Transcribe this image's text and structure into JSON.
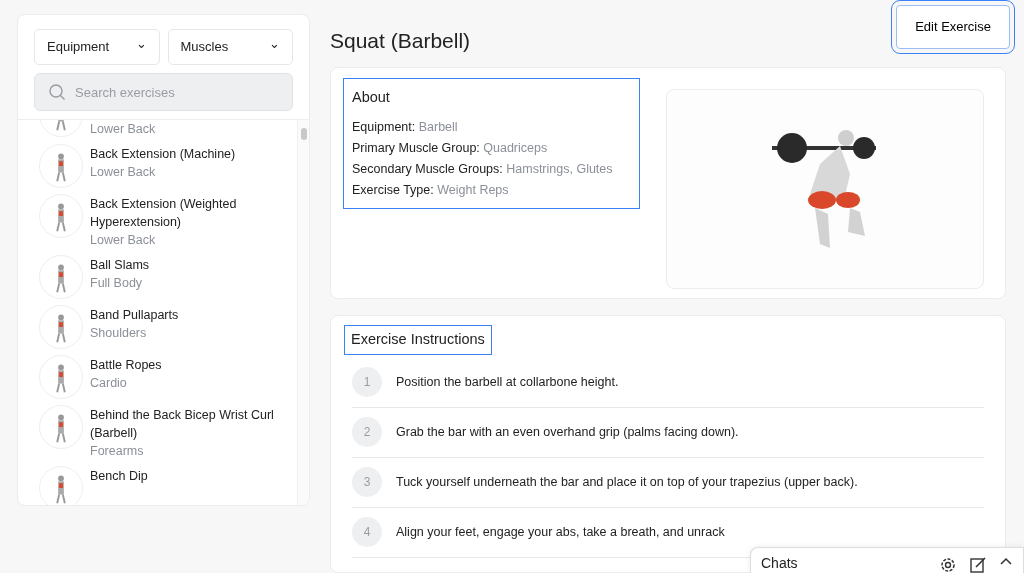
{
  "filters": [
    {
      "label": "Equipment",
      "caret": "⌄"
    },
    {
      "label": "Muscles",
      "caret": "⌄"
    }
  ],
  "search": {
    "placeholder": "Search exercises"
  },
  "exercises": [
    {
      "subtitle": "Lower Back"
    },
    {
      "title": "Back Extension (Machine)",
      "subtitle": "Lower Back"
    },
    {
      "title": "Back Extension (Weighted Hyperextension)",
      "subtitle": "Lower Back"
    },
    {
      "title": "Ball Slams",
      "subtitle": "Full Body"
    },
    {
      "title": "Band Pullaparts",
      "subtitle": "Shoulders"
    },
    {
      "title": "Battle Ropes",
      "subtitle": "Cardio"
    },
    {
      "title": "Behind the Back Bicep Wrist Curl (Barbell)",
      "subtitle": "Forearms"
    },
    {
      "title": "Bench Dip"
    }
  ],
  "page_title": "Squat (Barbell)",
  "edit_button": {
    "label": "Edit Exercise",
    "highlighted": true
  },
  "about": {
    "heading": "About",
    "highlighted": true,
    "fields": [
      {
        "label": "Equipment:",
        "value": "Barbell"
      },
      {
        "label": "Primary Muscle Group:",
        "value": "Quadriceps"
      },
      {
        "label": "Secondary Muscle Groups:",
        "value": "Hamstrings, Glutes"
      },
      {
        "label": "Exercise Type:",
        "value": "Weight Reps"
      }
    ]
  },
  "instructions": {
    "heading": "Exercise Instructions",
    "highlighted": true,
    "steps": [
      {
        "number": "1",
        "text": "Position the barbell at collarbone height."
      },
      {
        "number": "2",
        "text": "Grab the bar with an even overhand grip (palms facing down)."
      },
      {
        "number": "3",
        "text": "Tuck yourself underneath the bar and place it on top of your trapezius (upper back)."
      },
      {
        "number": "4",
        "text": "Align your feet, engage your abs, take a breath, and unrack"
      }
    ]
  },
  "chats": {
    "title": "Chats"
  }
}
